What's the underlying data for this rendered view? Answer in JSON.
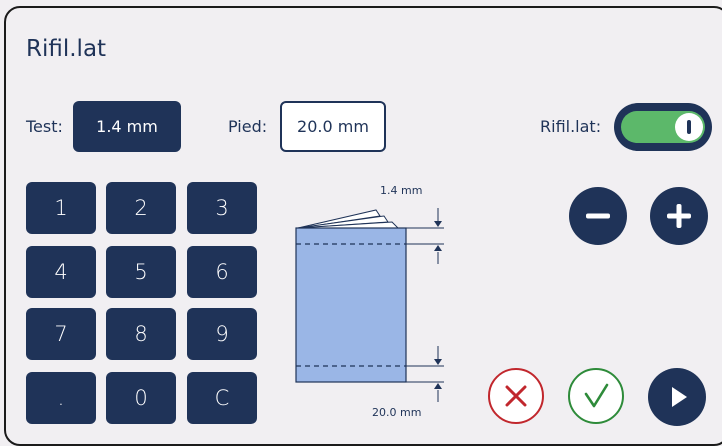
{
  "title": "Rifil.lat",
  "test": {
    "label": "Test:",
    "value": "1.4 mm"
  },
  "pied": {
    "label": "Pied:",
    "value": "20.0 mm"
  },
  "toggle": {
    "label": "Rifil.lat:",
    "state": "on"
  },
  "keypad": {
    "keys": [
      "1",
      "2",
      "3",
      "4",
      "5",
      "6",
      "7",
      "8",
      "9",
      ".",
      "0",
      "C"
    ]
  },
  "diagram": {
    "top_label": "1.4 mm",
    "bottom_label": "20.0 mm"
  },
  "icons": {
    "minus": "minus-icon",
    "plus": "plus-icon",
    "cancel": "close-icon",
    "confirm": "check-icon",
    "play": "play-icon"
  },
  "colors": {
    "primary": "#1f3358",
    "toggle_on": "#5cb86a",
    "cancel": "#c1272d",
    "confirm": "#2e8b3a",
    "paper": "#9ab6e6"
  }
}
